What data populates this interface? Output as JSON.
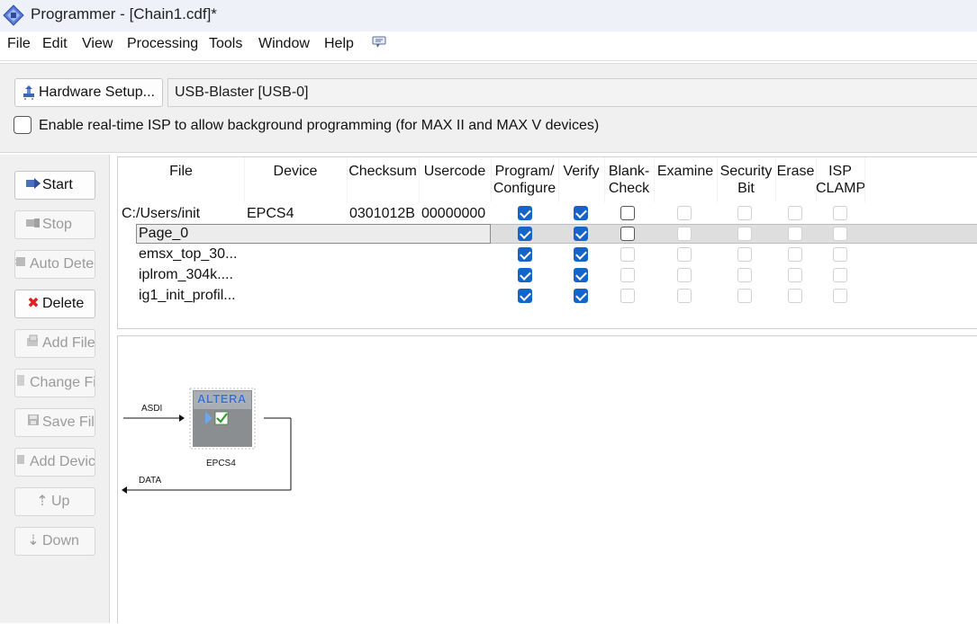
{
  "window": {
    "title": "Programmer - [Chain1.cdf]*"
  },
  "menu": [
    "File",
    "Edit",
    "View",
    "Processing",
    "Tools",
    "Window",
    "Help"
  ],
  "hardware": {
    "setup_label": "Hardware Setup...",
    "device": "USB-Blaster [USB-0]",
    "realtime_isp_label": "Enable real-time ISP to allow background programming (for MAX II and MAX V devices)",
    "realtime_isp_checked": false
  },
  "sidebar": [
    {
      "label": "Start",
      "icon": "start-icon",
      "enabled": true
    },
    {
      "label": "Stop",
      "icon": "stop-icon",
      "enabled": false
    },
    {
      "label": "Auto Detect",
      "icon": "auto-detect-icon",
      "enabled": false
    },
    {
      "label": "Delete",
      "icon": "delete-icon",
      "enabled": true
    },
    {
      "label": "Add File...",
      "icon": "add-file-icon",
      "enabled": false
    },
    {
      "label": "Change File",
      "icon": "change-file-icon",
      "enabled": false
    },
    {
      "label": "Save File",
      "icon": "save-file-icon",
      "enabled": false
    },
    {
      "label": "Add Device",
      "icon": "add-device-icon",
      "enabled": false
    },
    {
      "label": "Up",
      "icon": "up-icon",
      "enabled": false
    },
    {
      "label": "Down",
      "icon": "down-icon",
      "enabled": false
    }
  ],
  "table": {
    "headers": {
      "file": "File",
      "device": "Device",
      "checksum": "Checksum",
      "usercode": "Usercode",
      "program_1": "Program/",
      "program_2": "Configure",
      "verify": "Verify",
      "blank_1": "Blank-",
      "blank_2": "Check",
      "examine": "Examine",
      "security_1": "Security",
      "security_2": "Bit",
      "erase": "Erase",
      "isp_1": "ISP",
      "isp_2": "CLAMP"
    },
    "rows": [
      {
        "file": "C:/Users/init",
        "device": "EPCS4",
        "checksum": "0301012B",
        "usercode": "00000000",
        "program": true,
        "verify": true,
        "blank": "off"
      },
      {
        "file": "Page_0",
        "device": "",
        "checksum": "",
        "usercode": "",
        "program": true,
        "verify": true,
        "blank": "off"
      },
      {
        "file": "emsx_top_30...",
        "device": "",
        "checksum": "",
        "usercode": "",
        "program": true,
        "verify": true,
        "blank": "dis"
      },
      {
        "file": "iplrom_304k....",
        "device": "",
        "checksum": "",
        "usercode": "",
        "program": true,
        "verify": true,
        "blank": "dis"
      },
      {
        "file": "ig1_init_profil...",
        "device": "",
        "checksum": "",
        "usercode": "",
        "program": true,
        "verify": true,
        "blank": "dis"
      }
    ]
  },
  "chain": {
    "chip_logo": "ALTERA",
    "chip_name": "EPCS4",
    "input_label": "ASDI",
    "output_label": "DATA"
  },
  "colors": {
    "checkbox_checked": "#1565c8",
    "titlebar": "#eef1f8",
    "panel": "#f0f0f0"
  }
}
